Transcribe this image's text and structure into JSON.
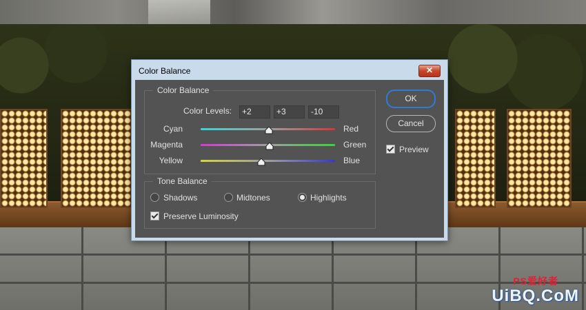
{
  "dialog": {
    "title": "Color Balance",
    "close_label": "✕"
  },
  "color_balance": {
    "group_label": "Color Balance",
    "levels_label": "Color Levels:",
    "levels": [
      "+2",
      "+3",
      "-10"
    ],
    "sliders": [
      {
        "left_label": "Cyan",
        "right_label": "Red",
        "value": 2,
        "min": -100,
        "max": 100,
        "left_color": "#37d6d6",
        "right_color": "#d63737"
      },
      {
        "left_label": "Magenta",
        "right_label": "Green",
        "value": 3,
        "min": -100,
        "max": 100,
        "left_color": "#d637d6",
        "right_color": "#37d637"
      },
      {
        "left_label": "Yellow",
        "right_label": "Blue",
        "value": -10,
        "min": -100,
        "max": 100,
        "left_color": "#d6d637",
        "right_color": "#3737d6"
      }
    ]
  },
  "tone_balance": {
    "group_label": "Tone Balance",
    "options": [
      "Shadows",
      "Midtones",
      "Highlights"
    ],
    "selected": "Highlights",
    "preserve_label": "Preserve Luminosity",
    "preserve_checked": true
  },
  "buttons": {
    "ok": "OK",
    "cancel": "Cancel"
  },
  "preview": {
    "label": "Preview",
    "checked": true
  },
  "watermark": {
    "text": "UiBQ.CoM",
    "sub": "PS爱好者"
  },
  "colors": {
    "dialog_bg": "#535353",
    "accent": "#2f7bd6",
    "frame": "#c9daea"
  }
}
